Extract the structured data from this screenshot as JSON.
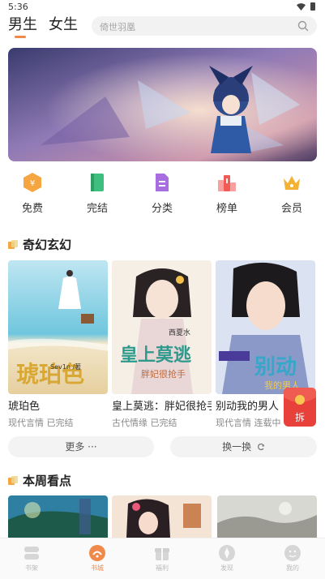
{
  "status": {
    "time": "5:36"
  },
  "header": {
    "tabs": [
      {
        "label": "男生"
      },
      {
        "label": "女生"
      }
    ],
    "search_placeholder": "倚世羽凰"
  },
  "shortcuts": [
    {
      "label": "免费",
      "icon": "free-icon",
      "color": "#f5a640"
    },
    {
      "label": "完结",
      "icon": "book-icon",
      "color": "#3fbf7f"
    },
    {
      "label": "分类",
      "icon": "category-icon",
      "color": "#a86ee0"
    },
    {
      "label": "榜单",
      "icon": "ranking-icon",
      "color": "#f15b55"
    },
    {
      "label": "会员",
      "icon": "crown-icon",
      "color": "#f2b233"
    }
  ],
  "sections": {
    "fantasy": {
      "title": "奇幻玄幻",
      "books": [
        {
          "title": "琥珀色",
          "meta": "现代言情 已完结",
          "cover_text": "琥珀色",
          "cover_sub": "Sev1n /著"
        },
        {
          "title": "皇上莫逃：胖妃很抢手",
          "meta": "古代情缘 已完结",
          "cover_text": "皇上莫逃",
          "cover_sub": "胖妃很抢手",
          "cover_author": "西夏水"
        },
        {
          "title": "别动我的男人",
          "meta": "现代言情 连载中",
          "cover_text": "别动",
          "cover_sub": "我的男人"
        }
      ],
      "more_label": "更多 ···",
      "refresh_label": "换一换"
    },
    "weekly": {
      "title": "本周看点"
    }
  },
  "redpacket": {
    "label": "拆"
  },
  "bottom_nav": [
    {
      "label": "书架",
      "icon": "bookshelf-icon",
      "active": false
    },
    {
      "label": "书城",
      "icon": "bookstore-icon",
      "active": true
    },
    {
      "label": "福利",
      "icon": "gift-icon",
      "active": false
    },
    {
      "label": "发现",
      "icon": "discover-icon",
      "active": false
    },
    {
      "label": "我的",
      "icon": "profile-icon",
      "active": false
    }
  ],
  "colors": {
    "accent": "#f08a4b",
    "redpacket": "#e8403a"
  }
}
